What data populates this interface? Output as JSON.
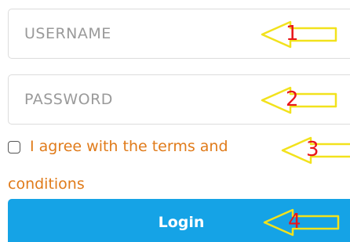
{
  "form": {
    "username": {
      "placeholder": "USERNAME",
      "value": ""
    },
    "password": {
      "placeholder": "PASSWORD",
      "value": ""
    },
    "terms": {
      "checked": false,
      "label_line1": "I agree with the terms and",
      "label_line2": "conditions"
    },
    "login_label": "Login"
  },
  "annotations": [
    {
      "number": "1",
      "target": "username"
    },
    {
      "number": "2",
      "target": "password"
    },
    {
      "number": "3",
      "target": "terms"
    },
    {
      "number": "4",
      "target": "login"
    }
  ],
  "colors": {
    "accent_button": "#15a3e6",
    "terms_text": "#e07b1a",
    "annotation_arrow_outline": "#f2e21c",
    "annotation_number": "#e8161b",
    "field_border": "#dcdcdc",
    "placeholder_text": "#9a9a9a"
  },
  "icons": {
    "annotation_arrow": "left-arrow-outline-icon",
    "checkbox": "checkbox-unchecked-icon"
  }
}
